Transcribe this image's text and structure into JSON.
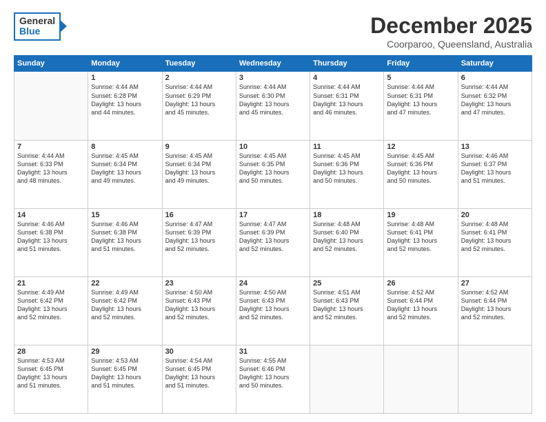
{
  "logo": {
    "line1": "General",
    "line2": "Blue"
  },
  "title": "December 2025",
  "subtitle": "Coorparoo, Queensland, Australia",
  "days_of_week": [
    "Sunday",
    "Monday",
    "Tuesday",
    "Wednesday",
    "Thursday",
    "Friday",
    "Saturday"
  ],
  "weeks": [
    [
      {
        "day": "",
        "text": ""
      },
      {
        "day": "1",
        "text": "Sunrise: 4:44 AM\nSunset: 6:28 PM\nDaylight: 13 hours\nand 44 minutes."
      },
      {
        "day": "2",
        "text": "Sunrise: 4:44 AM\nSunset: 6:29 PM\nDaylight: 13 hours\nand 45 minutes."
      },
      {
        "day": "3",
        "text": "Sunrise: 4:44 AM\nSunset: 6:30 PM\nDaylight: 13 hours\nand 45 minutes."
      },
      {
        "day": "4",
        "text": "Sunrise: 4:44 AM\nSunset: 6:31 PM\nDaylight: 13 hours\nand 46 minutes."
      },
      {
        "day": "5",
        "text": "Sunrise: 4:44 AM\nSunset: 6:31 PM\nDaylight: 13 hours\nand 47 minutes."
      },
      {
        "day": "6",
        "text": "Sunrise: 4:44 AM\nSunset: 6:32 PM\nDaylight: 13 hours\nand 47 minutes."
      }
    ],
    [
      {
        "day": "7",
        "text": "Sunrise: 4:44 AM\nSunset: 6:33 PM\nDaylight: 13 hours\nand 48 minutes."
      },
      {
        "day": "8",
        "text": "Sunrise: 4:45 AM\nSunset: 6:34 PM\nDaylight: 13 hours\nand 49 minutes."
      },
      {
        "day": "9",
        "text": "Sunrise: 4:45 AM\nSunset: 6:34 PM\nDaylight: 13 hours\nand 49 minutes."
      },
      {
        "day": "10",
        "text": "Sunrise: 4:45 AM\nSunset: 6:35 PM\nDaylight: 13 hours\nand 50 minutes."
      },
      {
        "day": "11",
        "text": "Sunrise: 4:45 AM\nSunset: 6:36 PM\nDaylight: 13 hours\nand 50 minutes."
      },
      {
        "day": "12",
        "text": "Sunrise: 4:45 AM\nSunset: 6:36 PM\nDaylight: 13 hours\nand 50 minutes."
      },
      {
        "day": "13",
        "text": "Sunrise: 4:46 AM\nSunset: 6:37 PM\nDaylight: 13 hours\nand 51 minutes."
      }
    ],
    [
      {
        "day": "14",
        "text": "Sunrise: 4:46 AM\nSunset: 6:38 PM\nDaylight: 13 hours\nand 51 minutes."
      },
      {
        "day": "15",
        "text": "Sunrise: 4:46 AM\nSunset: 6:38 PM\nDaylight: 13 hours\nand 51 minutes."
      },
      {
        "day": "16",
        "text": "Sunrise: 4:47 AM\nSunset: 6:39 PM\nDaylight: 13 hours\nand 52 minutes."
      },
      {
        "day": "17",
        "text": "Sunrise: 4:47 AM\nSunset: 6:39 PM\nDaylight: 13 hours\nand 52 minutes."
      },
      {
        "day": "18",
        "text": "Sunrise: 4:48 AM\nSunset: 6:40 PM\nDaylight: 13 hours\nand 52 minutes."
      },
      {
        "day": "19",
        "text": "Sunrise: 4:48 AM\nSunset: 6:41 PM\nDaylight: 13 hours\nand 52 minutes."
      },
      {
        "day": "20",
        "text": "Sunrise: 4:48 AM\nSunset: 6:41 PM\nDaylight: 13 hours\nand 52 minutes."
      }
    ],
    [
      {
        "day": "21",
        "text": "Sunrise: 4:49 AM\nSunset: 6:42 PM\nDaylight: 13 hours\nand 52 minutes."
      },
      {
        "day": "22",
        "text": "Sunrise: 4:49 AM\nSunset: 6:42 PM\nDaylight: 13 hours\nand 52 minutes."
      },
      {
        "day": "23",
        "text": "Sunrise: 4:50 AM\nSunset: 6:43 PM\nDaylight: 13 hours\nand 52 minutes."
      },
      {
        "day": "24",
        "text": "Sunrise: 4:50 AM\nSunset: 6:43 PM\nDaylight: 13 hours\nand 52 minutes."
      },
      {
        "day": "25",
        "text": "Sunrise: 4:51 AM\nSunset: 6:43 PM\nDaylight: 13 hours\nand 52 minutes."
      },
      {
        "day": "26",
        "text": "Sunrise: 4:52 AM\nSunset: 6:44 PM\nDaylight: 13 hours\nand 52 minutes."
      },
      {
        "day": "27",
        "text": "Sunrise: 4:52 AM\nSunset: 6:44 PM\nDaylight: 13 hours\nand 52 minutes."
      }
    ],
    [
      {
        "day": "28",
        "text": "Sunrise: 4:53 AM\nSunset: 6:45 PM\nDaylight: 13 hours\nand 51 minutes."
      },
      {
        "day": "29",
        "text": "Sunrise: 4:53 AM\nSunset: 6:45 PM\nDaylight: 13 hours\nand 51 minutes."
      },
      {
        "day": "30",
        "text": "Sunrise: 4:54 AM\nSunset: 6:45 PM\nDaylight: 13 hours\nand 51 minutes."
      },
      {
        "day": "31",
        "text": "Sunrise: 4:55 AM\nSunset: 6:46 PM\nDaylight: 13 hours\nand 50 minutes."
      },
      {
        "day": "",
        "text": ""
      },
      {
        "day": "",
        "text": ""
      },
      {
        "day": "",
        "text": ""
      }
    ]
  ]
}
